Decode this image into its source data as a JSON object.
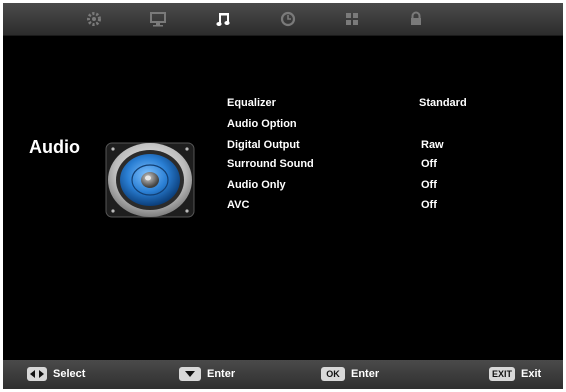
{
  "tabs": [
    {
      "icon": "gear-icon",
      "active": false
    },
    {
      "icon": "monitor-icon",
      "active": false
    },
    {
      "icon": "music-note-icon",
      "active": true
    },
    {
      "icon": "clock-icon",
      "active": false
    },
    {
      "icon": "grid-icon",
      "active": false
    },
    {
      "icon": "lock-icon",
      "active": false
    }
  ],
  "section": {
    "title": "Audio",
    "icon": "speaker-icon"
  },
  "menu": [
    {
      "label": "Equalizer",
      "value": "Standard"
    },
    {
      "label": "Audio Option",
      "value": ""
    },
    {
      "label": "Digital Output",
      "value": "Raw"
    },
    {
      "label": "Surround Sound",
      "value": "Off"
    },
    {
      "label": "Audio Only",
      "value": "Off"
    },
    {
      "label": "AVC",
      "value": "Off"
    }
  ],
  "footer": {
    "select": {
      "key": "left-right-arrows-icon",
      "label": "Select"
    },
    "enter_arrow": {
      "key": "down-arrow-icon",
      "label": "Enter"
    },
    "ok": {
      "key_label": "OK",
      "label": "Enter"
    },
    "exit": {
      "key_label": "EXIT",
      "label": "Exit"
    }
  },
  "colors": {
    "background": "#000000",
    "bar": "#3c3c3c",
    "active_icon": "#ffffff",
    "inactive_icon": "#808080",
    "speaker_blue": "#2a7fd4"
  }
}
